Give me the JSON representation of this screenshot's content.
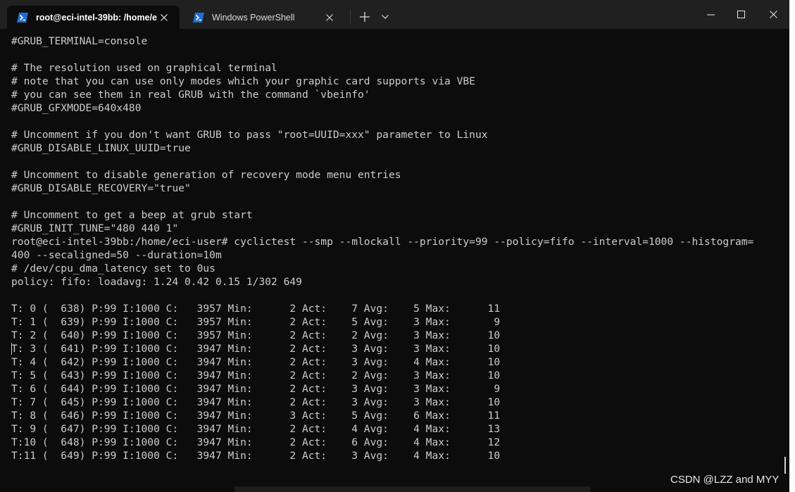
{
  "window": {
    "tabs": [
      {
        "label": "root@eci-intel-39bb: /home/e",
        "icon": "powershell-icon",
        "active": true
      },
      {
        "label": "Windows PowerShell",
        "icon": "powershell-icon",
        "active": false
      }
    ],
    "controls": {
      "new_tab": "+",
      "dropdown": "chevron-down-icon",
      "minimize": "minimize-icon",
      "maximize": "maximize-icon",
      "close": "close-icon"
    }
  },
  "terminal": {
    "lines": [
      "#GRUB_TERMINAL=console",
      "",
      "# The resolution used on graphical terminal",
      "# note that you can use only modes which your graphic card supports via VBE",
      "# you can see them in real GRUB with the command `vbeinfo'",
      "#GRUB_GFXMODE=640x480",
      "",
      "# Uncomment if you don't want GRUB to pass \"root=UUID=xxx\" parameter to Linux",
      "#GRUB_DISABLE_LINUX_UUID=true",
      "",
      "# Uncomment to disable generation of recovery mode menu entries",
      "#GRUB_DISABLE_RECOVERY=\"true\"",
      "",
      "# Uncomment to get a beep at grub start",
      "#GRUB_INIT_TUNE=\"480 440 1\"",
      "root@eci-intel-39bb:/home/eci-user# cyclictest --smp --mlockall --priority=99 --policy=fifo --interval=1000 --histogram=",
      "400 --secaligned=50 --duration=10m",
      "# /dev/cpu_dma_latency set to 0us",
      "policy: fifo: loadavg: 1.24 0.42 0.15 1/302 649",
      "",
      "T: 0 (  638) P:99 I:1000 C:   3957 Min:      2 Act:    7 Avg:    5 Max:      11",
      "T: 1 (  639) P:99 I:1000 C:   3957 Min:      2 Act:    5 Avg:    3 Max:       9",
      "T: 2 (  640) P:99 I:1000 C:   3957 Min:      2 Act:    2 Avg:    3 Max:      10",
      "T: 3 (  641) P:99 I:1000 C:   3947 Min:      2 Act:    3 Avg:    3 Max:      10",
      "T: 4 (  642) P:99 I:1000 C:   3947 Min:      2 Act:    3 Avg:    4 Max:      10",
      "T: 5 (  643) P:99 I:1000 C:   3947 Min:      2 Act:    2 Avg:    3 Max:      10",
      "T: 6 (  644) P:99 I:1000 C:   3947 Min:      2 Act:    3 Avg:    3 Max:       9",
      "T: 7 (  645) P:99 I:1000 C:   3947 Min:      2 Act:    3 Avg:    3 Max:      10",
      "T: 8 (  646) P:99 I:1000 C:   3947 Min:      3 Act:    5 Avg:    6 Max:      11",
      "T: 9 (  647) P:99 I:1000 C:   3947 Min:      2 Act:    4 Avg:    4 Max:      13",
      "T:10 (  648) P:99 I:1000 C:   3947 Min:      2 Act:    6 Avg:    4 Max:      12",
      "T:11 (  649) P:99 I:1000 C:   3947 Min:      2 Act:    3 Avg:    4 Max:      10"
    ]
  },
  "watermark": "CSDN @LZZ and MYY"
}
